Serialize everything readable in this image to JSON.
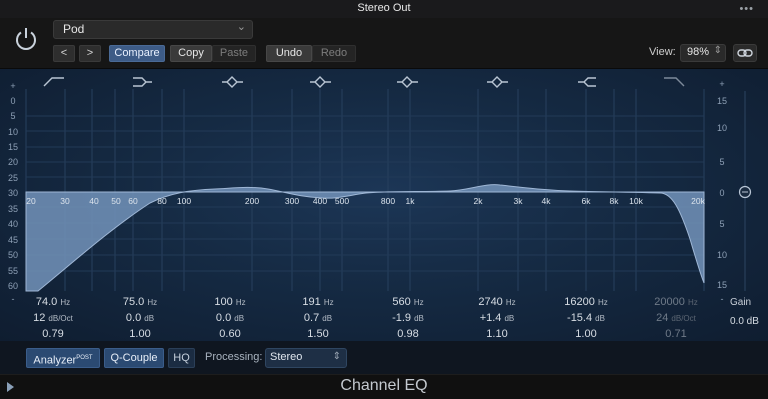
{
  "window": {
    "title": "Stereo Out",
    "menu_glyph": "•••"
  },
  "header": {
    "preset": "Pod",
    "buttons": {
      "prev": "<",
      "next": ">",
      "compare": "Compare",
      "copy": "Copy",
      "paste": "Paste",
      "undo": "Undo",
      "redo": "Redo"
    },
    "view_label": "View:",
    "view_zoom": "98%"
  },
  "graph": {
    "db_scale_left": [
      "+",
      "0",
      "5",
      "10",
      "15",
      "20",
      "25",
      "30",
      "35",
      "40",
      "45",
      "50",
      "55",
      "60",
      "-"
    ],
    "db_scale_right": [
      "+",
      "15",
      "10",
      "5",
      "0",
      "5",
      "10",
      "15",
      "-"
    ],
    "freq_labels": [
      "20",
      "30",
      "40",
      "50",
      "60",
      "80",
      "100",
      "200",
      "300",
      "400",
      "500",
      "800",
      "1k",
      "2k",
      "3k",
      "4k",
      "6k",
      "8k",
      "10k",
      "20k"
    ],
    "band_icons": [
      "low-cut-icon",
      "low-shelf-icon",
      "bell-icon",
      "bell-icon",
      "bell-icon",
      "bell-icon",
      "high-shelf-icon",
      "high-cut-icon"
    ],
    "colors": {
      "curve_fill": "#6f8fb6",
      "curve_line": "#9fb7d6",
      "background": "#172c46"
    }
  },
  "bands": [
    {
      "freq": "74.0",
      "freq_unit": "Hz",
      "gain": "12",
      "gain_unit": "dB/Oct",
      "q": "0.79",
      "active": true
    },
    {
      "freq": "75.0",
      "freq_unit": "Hz",
      "gain": "0.0",
      "gain_unit": "dB",
      "q": "1.00",
      "active": true
    },
    {
      "freq": "100",
      "freq_unit": "Hz",
      "gain": "0.0",
      "gain_unit": "dB",
      "q": "0.60",
      "active": true
    },
    {
      "freq": "191",
      "freq_unit": "Hz",
      "gain": "0.7",
      "gain_unit": "dB",
      "q": "1.50",
      "active": true
    },
    {
      "freq": "560",
      "freq_unit": "Hz",
      "gain": "-1.9",
      "gain_unit": "dB",
      "q": "0.98",
      "active": true
    },
    {
      "freq": "2740",
      "freq_unit": "Hz",
      "gain": "+1.4",
      "gain_unit": "dB",
      "q": "1.10",
      "active": true
    },
    {
      "freq": "16200",
      "freq_unit": "Hz",
      "gain": "-15.4",
      "gain_unit": "dB",
      "q": "1.00",
      "active": true
    },
    {
      "freq": "20000",
      "freq_unit": "Hz",
      "gain": "24",
      "gain_unit": "dB/Oct",
      "q": "0.71",
      "active": false
    }
  ],
  "gain": {
    "label": "Gain",
    "value": "0.0 dB"
  },
  "controls": {
    "analyzer": "Analyzer",
    "analyzer_sup": "POST",
    "qcouple": "Q-Couple",
    "hq": "HQ",
    "processing_label": "Processing:",
    "processing_value": "Stereo"
  },
  "footer": {
    "plugin_name": "Channel EQ"
  }
}
